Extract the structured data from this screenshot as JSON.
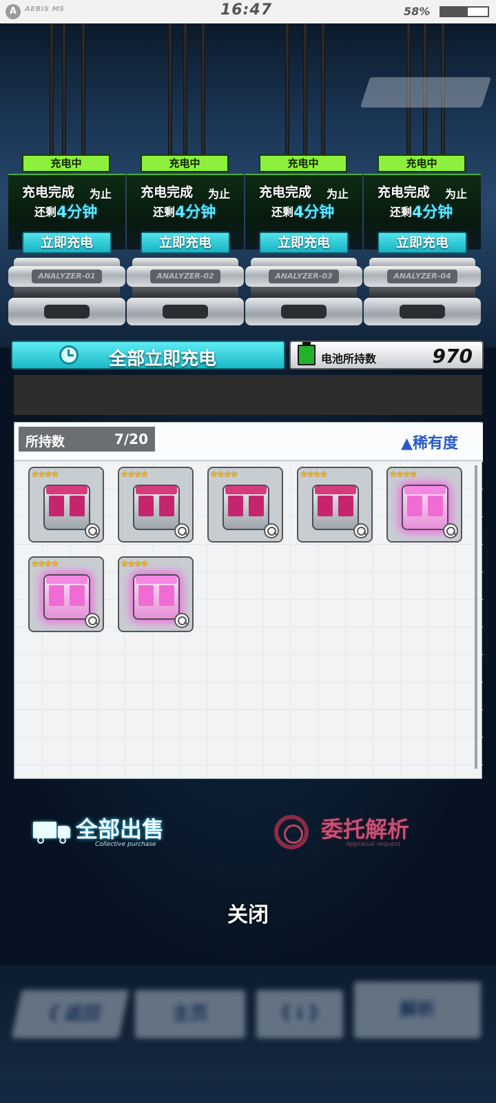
{
  "status_bar": {
    "logo_glyph": "A",
    "brand": "AEBIS MS",
    "time": "16:47",
    "battery_percent_text": "58%",
    "battery_level": 0.58
  },
  "slots": [
    {
      "status": "充电中",
      "line1": "充电完成",
      "line1_suffix": "为止",
      "remaining_prefix": "还剩",
      "remaining_time": "4分钟",
      "button_label": "立即充电",
      "machine_label": "ANALYZER-01"
    },
    {
      "status": "充电中",
      "line1": "充电完成",
      "line1_suffix": "为止",
      "remaining_prefix": "还剩",
      "remaining_time": "4分钟",
      "button_label": "立即充电",
      "machine_label": "ANALYZER-02"
    },
    {
      "status": "充电中",
      "line1": "充电完成",
      "line1_suffix": "为止",
      "remaining_prefix": "还剩",
      "remaining_time": "4分钟",
      "button_label": "立即充电",
      "machine_label": "ANALYZER-03"
    },
    {
      "status": "充电中",
      "line1": "充电完成",
      "line1_suffix": "为止",
      "remaining_prefix": "还剩",
      "remaining_time": "4分钟",
      "button_label": "立即充电",
      "machine_label": "ANALYZER-04"
    }
  ],
  "charge_all": {
    "label": "全部立即充电",
    "icon": "clock-icon"
  },
  "battery": {
    "label": "电池所持数",
    "count": "970",
    "icon": "battery-icon"
  },
  "inventory": {
    "count_label": "所持数",
    "count_value": "7/20",
    "sort_label": "▲稀有度",
    "items": [
      {
        "stars": "★★★★",
        "variant": "standard"
      },
      {
        "stars": "★★★★",
        "variant": "standard"
      },
      {
        "stars": "★★★★",
        "variant": "standard"
      },
      {
        "stars": "★★★★",
        "variant": "standard"
      },
      {
        "stars": "★★★★",
        "variant": "glow"
      },
      {
        "stars": "★★★★",
        "variant": "glow"
      },
      {
        "stars": "★★★★",
        "variant": "glow"
      }
    ]
  },
  "actions": {
    "sell_all": {
      "label": "全部出售",
      "sub": "Collective purchase",
      "icon": "truck-icon"
    },
    "appraise": {
      "label": "委托解析",
      "sub": "Appraisal request",
      "icon": "appraise-icon"
    },
    "close": "关闭"
  },
  "nav": {
    "back": "《 返回",
    "home": "主页",
    "info": "《 i 》",
    "char": "解析"
  },
  "colors": {
    "accent_cyan": "#1cb9c8",
    "status_green": "#8cf03c",
    "sort_blue": "#2a58c8",
    "appraise_pink": "#c65277"
  }
}
